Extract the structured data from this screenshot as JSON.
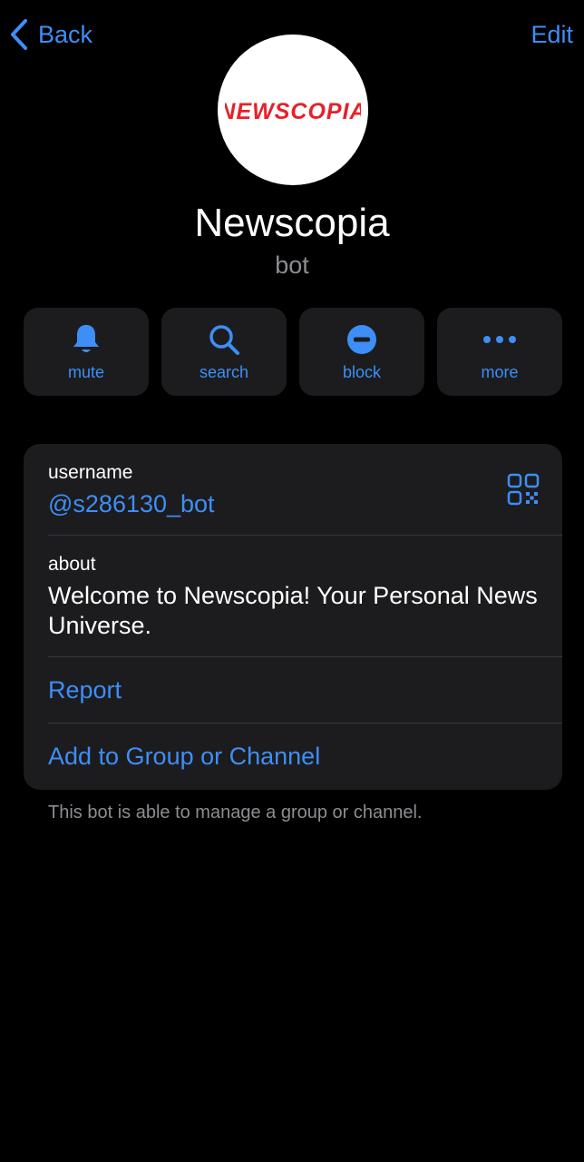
{
  "nav": {
    "back_label": "Back",
    "edit_label": "Edit"
  },
  "profile": {
    "avatar_logo_text": "NEWSCOPIA",
    "name": "Newscopia",
    "subtitle": "bot"
  },
  "actions": [
    {
      "label": "mute",
      "icon": "bell-icon"
    },
    {
      "label": "search",
      "icon": "search-icon"
    },
    {
      "label": "block",
      "icon": "block-icon"
    },
    {
      "label": "more",
      "icon": "more-icon"
    }
  ],
  "info": {
    "username_label": "username",
    "username_value": "@s286130_bot",
    "about_label": "about",
    "about_value": "Welcome to Newscopia! Your Personal News Universe.",
    "report_label": "Report",
    "add_label": "Add to Group or Channel"
  },
  "footer_note": "This bot is able to manage a group or channel.",
  "colors": {
    "accent": "#3e8ef7",
    "background": "#000000",
    "card": "#1c1c1e",
    "secondary_text": "#8d8d93",
    "logo_red": "#e8202a"
  }
}
